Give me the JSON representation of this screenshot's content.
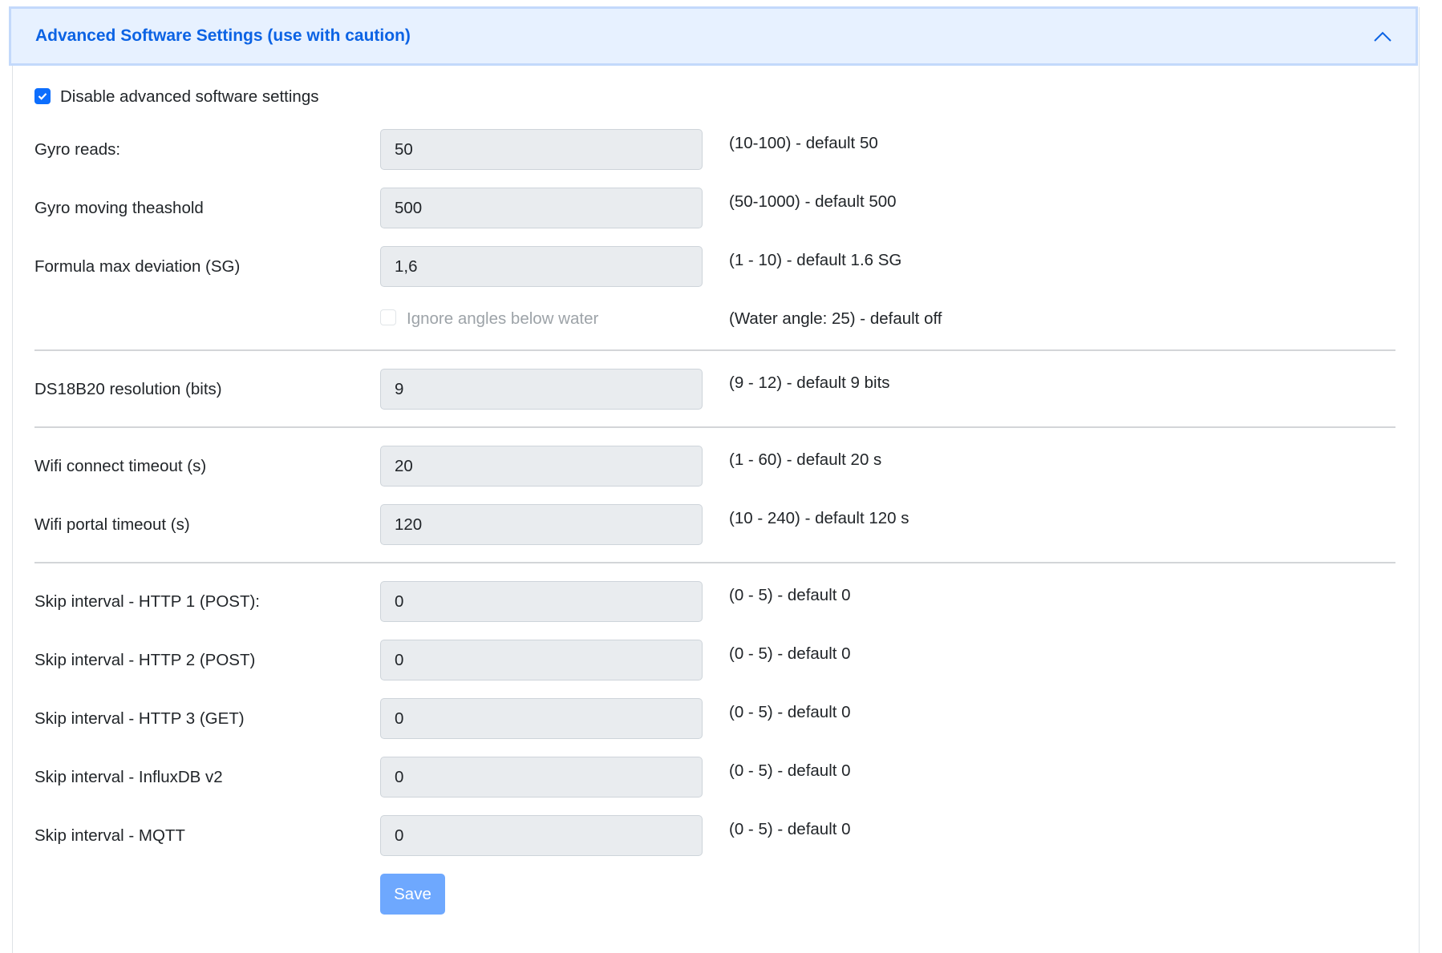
{
  "header": {
    "title": "Advanced Software Settings (use with caution)",
    "toggle_icon": "chevron-up-icon",
    "accent": "#0d6efd"
  },
  "disable_checkbox": {
    "label": "Disable advanced software settings",
    "checked": true
  },
  "fields": [
    {
      "label": "Gyro reads:",
      "value": "50",
      "help": "(10-100) - default 50"
    },
    {
      "label": "Gyro moving theashold",
      "value": "500",
      "help": "(50-1000) - default 500"
    },
    {
      "label": "Formula max deviation (SG)",
      "value": "1,6",
      "help": "(1 - 10) - default 1.6 SG"
    },
    {
      "label": "DS18B20 resolution (bits)",
      "value": "9",
      "help": "(9 - 12) - default 9 bits"
    },
    {
      "label": "Wifi connect timeout (s)",
      "value": "20",
      "help": "(1 - 60) - default 20 s"
    },
    {
      "label": "Wifi portal timeout (s)",
      "value": "120",
      "help": "(10 - 240) - default 120 s"
    },
    {
      "label": "Skip interval - HTTP 1 (POST):",
      "value": "0",
      "help": "(0 - 5) - default 0"
    },
    {
      "label": "Skip interval - HTTP 2 (POST)",
      "value": "0",
      "help": "(0 - 5) - default 0"
    },
    {
      "label": "Skip interval - HTTP 3 (GET)",
      "value": "0",
      "help": "(0 - 5) - default 0"
    },
    {
      "label": "Skip interval - InfluxDB v2",
      "value": "0",
      "help": "(0 - 5) - default 0"
    },
    {
      "label": "Skip interval - MQTT",
      "value": "0",
      "help": "(0 - 5) - default 0"
    }
  ],
  "ignore_angles": {
    "label": "Ignore angles below water",
    "checked": false,
    "help": "(Water angle: 25) - default off"
  },
  "save_label": "Save"
}
